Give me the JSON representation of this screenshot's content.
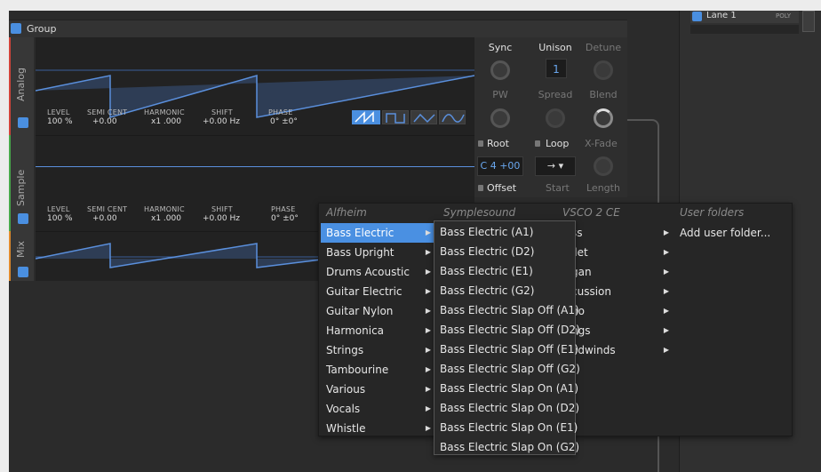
{
  "group": {
    "title": "Group"
  },
  "lane": {
    "title": "Lane 1",
    "badge": "POLY"
  },
  "tabs": {
    "analog": "Analog",
    "sample": "Sample",
    "mix": "Mix"
  },
  "params": {
    "level_label": "LEVEL",
    "level_value": "100 %",
    "semi_label": "SEMI CENT",
    "semi_value": "+0.00",
    "harm_label": "HARMONIC",
    "harm_value": "x1 .000",
    "shift_label": "SHIFT",
    "shift_value": "+0.00 Hz",
    "phase_label": "PHASE",
    "phase_value": "0° ±0°"
  },
  "controls": {
    "sync": "Sync",
    "unison": "Unison",
    "detune": "Detune",
    "unison_value": "1",
    "pw": "PW",
    "spread": "Spread",
    "blend": "Blend",
    "root": "Root",
    "loop": "Loop",
    "xfade": "X-Fade",
    "root_value": "C 4 +00",
    "loop_value": "→ ▾",
    "offset": "Offset",
    "start": "Start",
    "length": "Length"
  },
  "menu": {
    "headers": [
      "Alfheim",
      "Symplesound",
      "VSCO 2 CE",
      "User folders"
    ],
    "categories": [
      "Bass Electric",
      "Bass Upright",
      "Drums Acoustic",
      "Guitar Electric",
      "Guitar Nylon",
      "Harmonica",
      "Strings",
      "Tambourine",
      "Various",
      "Vocals",
      "Whistle"
    ],
    "samples": [
      "Bass Electric (A1)",
      "Bass Electric (D2)",
      "Bass Electric (E1)",
      "Bass Electric (G2)",
      "Bass Electric Slap Off (A1)",
      "Bass Electric Slap Off (D2)",
      "Bass Electric Slap Off (E1)",
      "Bass Electric Slap Off (G2)",
      "Bass Electric Slap On (A1)",
      "Bass Electric Slap On (D2)",
      "Bass Electric Slap On (E1)",
      "Bass Electric Slap On (G2)"
    ],
    "vsco": [
      "ss",
      "llet",
      "gan",
      "cussion",
      "no",
      "ngs",
      "odwinds"
    ],
    "user": [
      "Add user folder..."
    ]
  }
}
